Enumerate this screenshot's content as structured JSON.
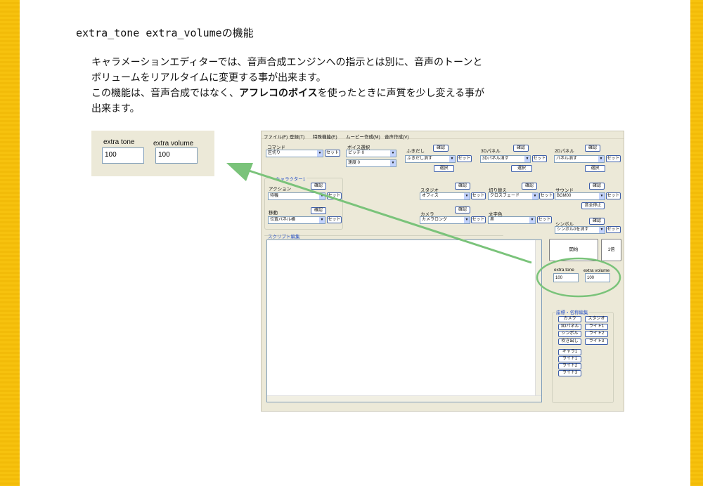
{
  "heading": "extra_tone extra_volumeの機能",
  "paragraph": {
    "line1": "キャラメーションエディターでは、音声合成エンジンへの指示とは別に、音声のトーンと",
    "line2": "ボリュームをリアルタイムに変更する事が出来ます。",
    "line3_pre": "この機能は、音声合成ではなく、",
    "line3_bold": "アフレコのボイス",
    "line3_post": "を使ったときに声質を少し変える事が",
    "line4": "出来ます。"
  },
  "callout": {
    "tone_label": "extra tone",
    "volume_label": "extra volume",
    "tone_value": "100",
    "volume_value": "100"
  },
  "app": {
    "menu": [
      "ファイル(F)",
      "登録(T)",
      "特殊機能(E)",
      "ムービー作成(M)",
      "音声作成(V)"
    ],
    "command_label": "コマンド",
    "command_value": "区切り",
    "set": "セット",
    "confirm": "確認",
    "select": "選択",
    "voice_label": "ボイス選択",
    "pitch_value": "ピッチ 0",
    "speed_value": "速度 0",
    "fukidashi_label": "ふきだし",
    "fukidashi_value": "ふきだし消す",
    "panel3d_label": "3Dパネル",
    "panel3d_value": "3Dパネル消す",
    "panel2d_label": "2Dパネル",
    "panel2d_value": "パネル消す",
    "character_label": "キャラクター1",
    "action_label": "アクション",
    "action_value": "待機",
    "move_label": "移動",
    "move_value": "位置パネル横",
    "studio_label": "スタジオ",
    "studio_value": "オフィス",
    "switch_label": "切り替え",
    "switch_value": "クロスフェード",
    "sound_label": "サウンド",
    "sound_value": "BGM00",
    "stop_all_sound": "音全停止",
    "camera_label": "カメラ",
    "camera_value": "カメラロング",
    "textcolor_label": "文字色",
    "textcolor_value": "黒",
    "symbol_label": "シンボル",
    "symbol_value": "シンボル0を消す",
    "script_label": "スクリプト編集",
    "start_button": "開始",
    "speed_button": "1倍",
    "extra_tone_label": "extra tone",
    "extra_volume_label": "extra volume",
    "extra_tone_value": "100",
    "extra_volume_value": "100",
    "coord_label": "座標・名称編集",
    "coord_buttons": [
      "カメラ",
      "スタジオ",
      "3Dパネル",
      "ライト1",
      "シンボル",
      "ライト2",
      "吹き出し",
      "ライト3"
    ],
    "coord_buttons2": [
      "キャラ1",
      "ライト1",
      "ライト2",
      "ライト3"
    ]
  },
  "colors": {
    "page_border": "#f7c20e",
    "window_bg": "#ece9d8",
    "arrow": "#7ac37a"
  }
}
